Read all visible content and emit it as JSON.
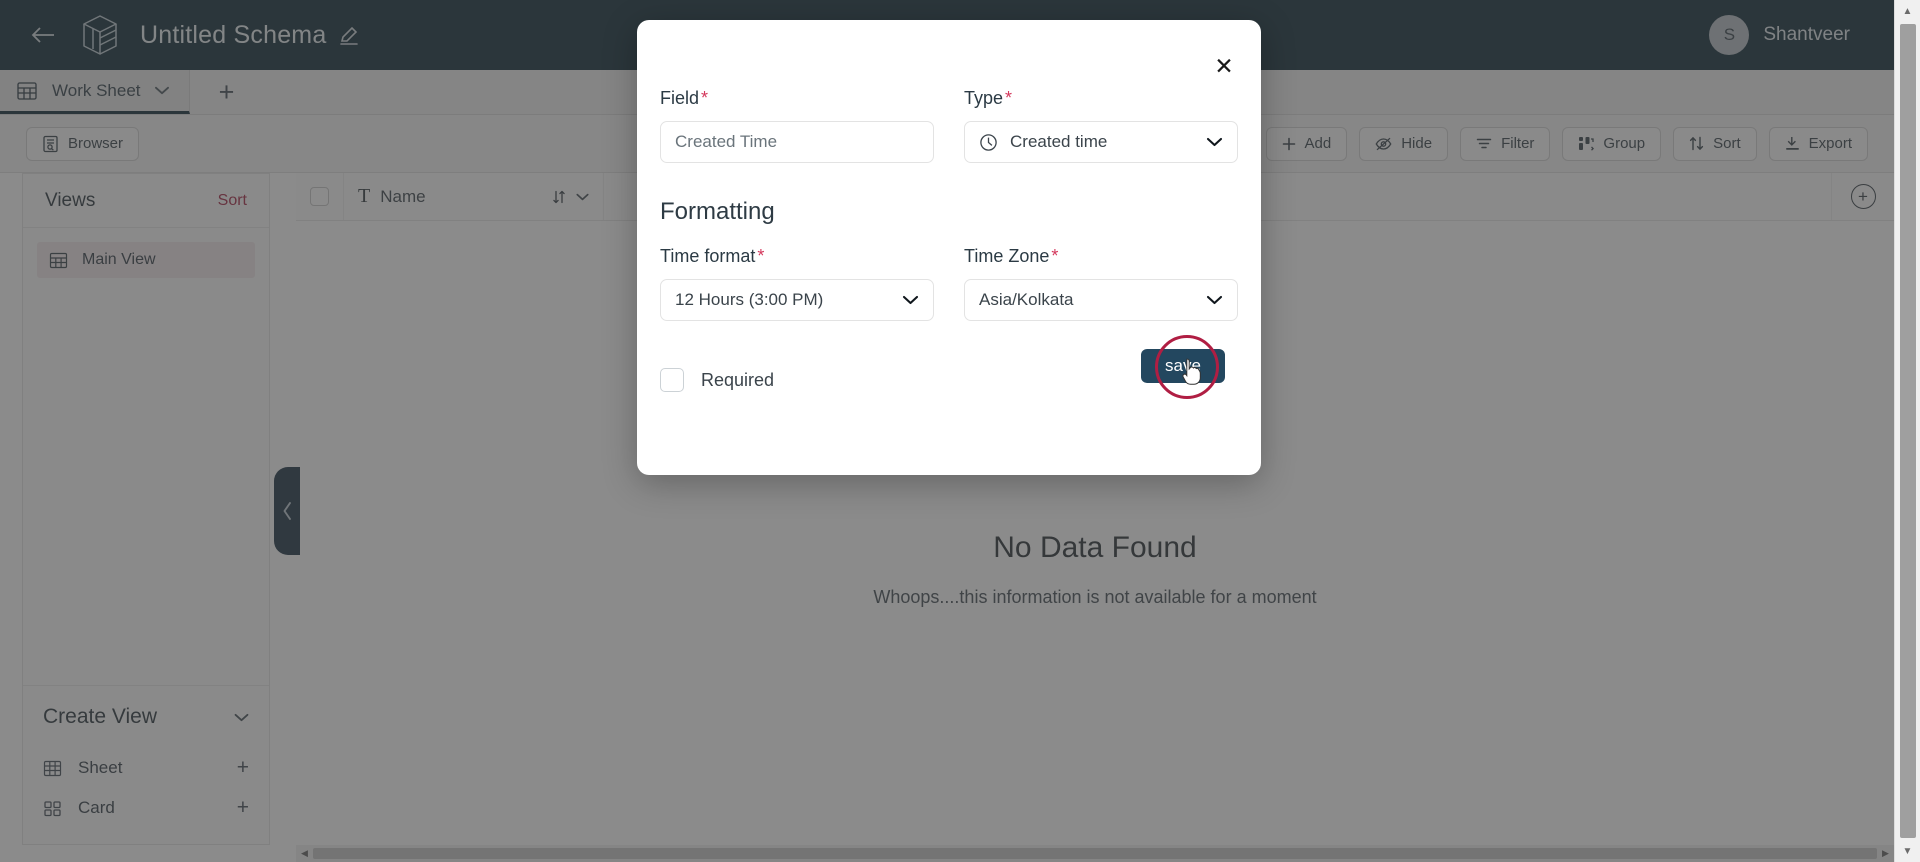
{
  "topbar": {
    "back_icon": "arrow-left-icon",
    "logo_icon": "cube-logo-icon",
    "title": "Untitled Schema",
    "edit_icon": "pencil-icon",
    "user": {
      "initial": "S",
      "name": "Shantveer"
    }
  },
  "tabstrip": {
    "tabs": [
      {
        "icon": "grid-icon",
        "label": "Work Sheet",
        "caret": "chevron-down-icon",
        "active": true
      }
    ],
    "add_tab_label": "+"
  },
  "toolbar": {
    "browser_label": "Browser",
    "browser_icon": "browser-icon",
    "right_buttons": [
      {
        "label": "Add",
        "icon": "plus-icon"
      },
      {
        "label": "Hide",
        "icon": "eye-off-icon"
      },
      {
        "label": "Filter",
        "icon": "filter-icon"
      },
      {
        "label": "Group",
        "icon": "group-icon"
      },
      {
        "label": "Sort",
        "icon": "sort-icon"
      },
      {
        "label": "Export",
        "icon": "download-icon"
      }
    ]
  },
  "sidebar": {
    "views_title": "Views",
    "sort_link": "Sort",
    "views": [
      {
        "icon": "grid-icon",
        "label": "Main View",
        "selected": true
      }
    ],
    "create_view": {
      "title": "Create View",
      "caret": "chevron-down-icon",
      "items": [
        {
          "icon": "sheet-icon",
          "label": "Sheet",
          "action": "+"
        },
        {
          "icon": "card-icon",
          "label": "Card",
          "action": "+"
        }
      ]
    },
    "collapse_handle_icon": "chevron-left-icon"
  },
  "grid": {
    "columns": [
      {
        "type_icon": "text-type-icon",
        "name": "Name",
        "sort_icon": "sort-arrows-icon",
        "caret": "chevron-down-icon"
      }
    ],
    "add_column_label": "+",
    "rows": [],
    "empty_state": {
      "illustration": "empty-folder-search-icon",
      "title": "No Data Found",
      "subtitle": "Whoops....this information is not available for a moment"
    }
  },
  "modal": {
    "close_icon": "close-icon",
    "field": {
      "label": "Field",
      "required_marker": "*",
      "value": "",
      "placeholder": "Created Time"
    },
    "type": {
      "label": "Type",
      "required_marker": "*",
      "icon": "clock-icon",
      "value": "Created time",
      "caret": "chevron-down-icon"
    },
    "formatting_title": "Formatting",
    "time_format": {
      "label": "Time format",
      "required_marker": "*",
      "value": "12 Hours (3:00 PM)",
      "caret": "chevron-down-icon"
    },
    "time_zone": {
      "label": "Time Zone",
      "required_marker": "*",
      "value": "Asia/Kolkata",
      "caret": "chevron-down-icon"
    },
    "required_checkbox": {
      "label": "Required",
      "checked": false
    },
    "save_button": {
      "label": "save"
    }
  },
  "scrollbars": {
    "h_left_arrow": "◀",
    "h_right_arrow": "▶",
    "v_up_arrow": "▲",
    "v_down_arrow": "▼"
  },
  "colors": {
    "header_bg": "#04202e",
    "accent_crimson": "#a01c3c",
    "save_navy": "#23475f",
    "ring_red": "#b01e43"
  }
}
